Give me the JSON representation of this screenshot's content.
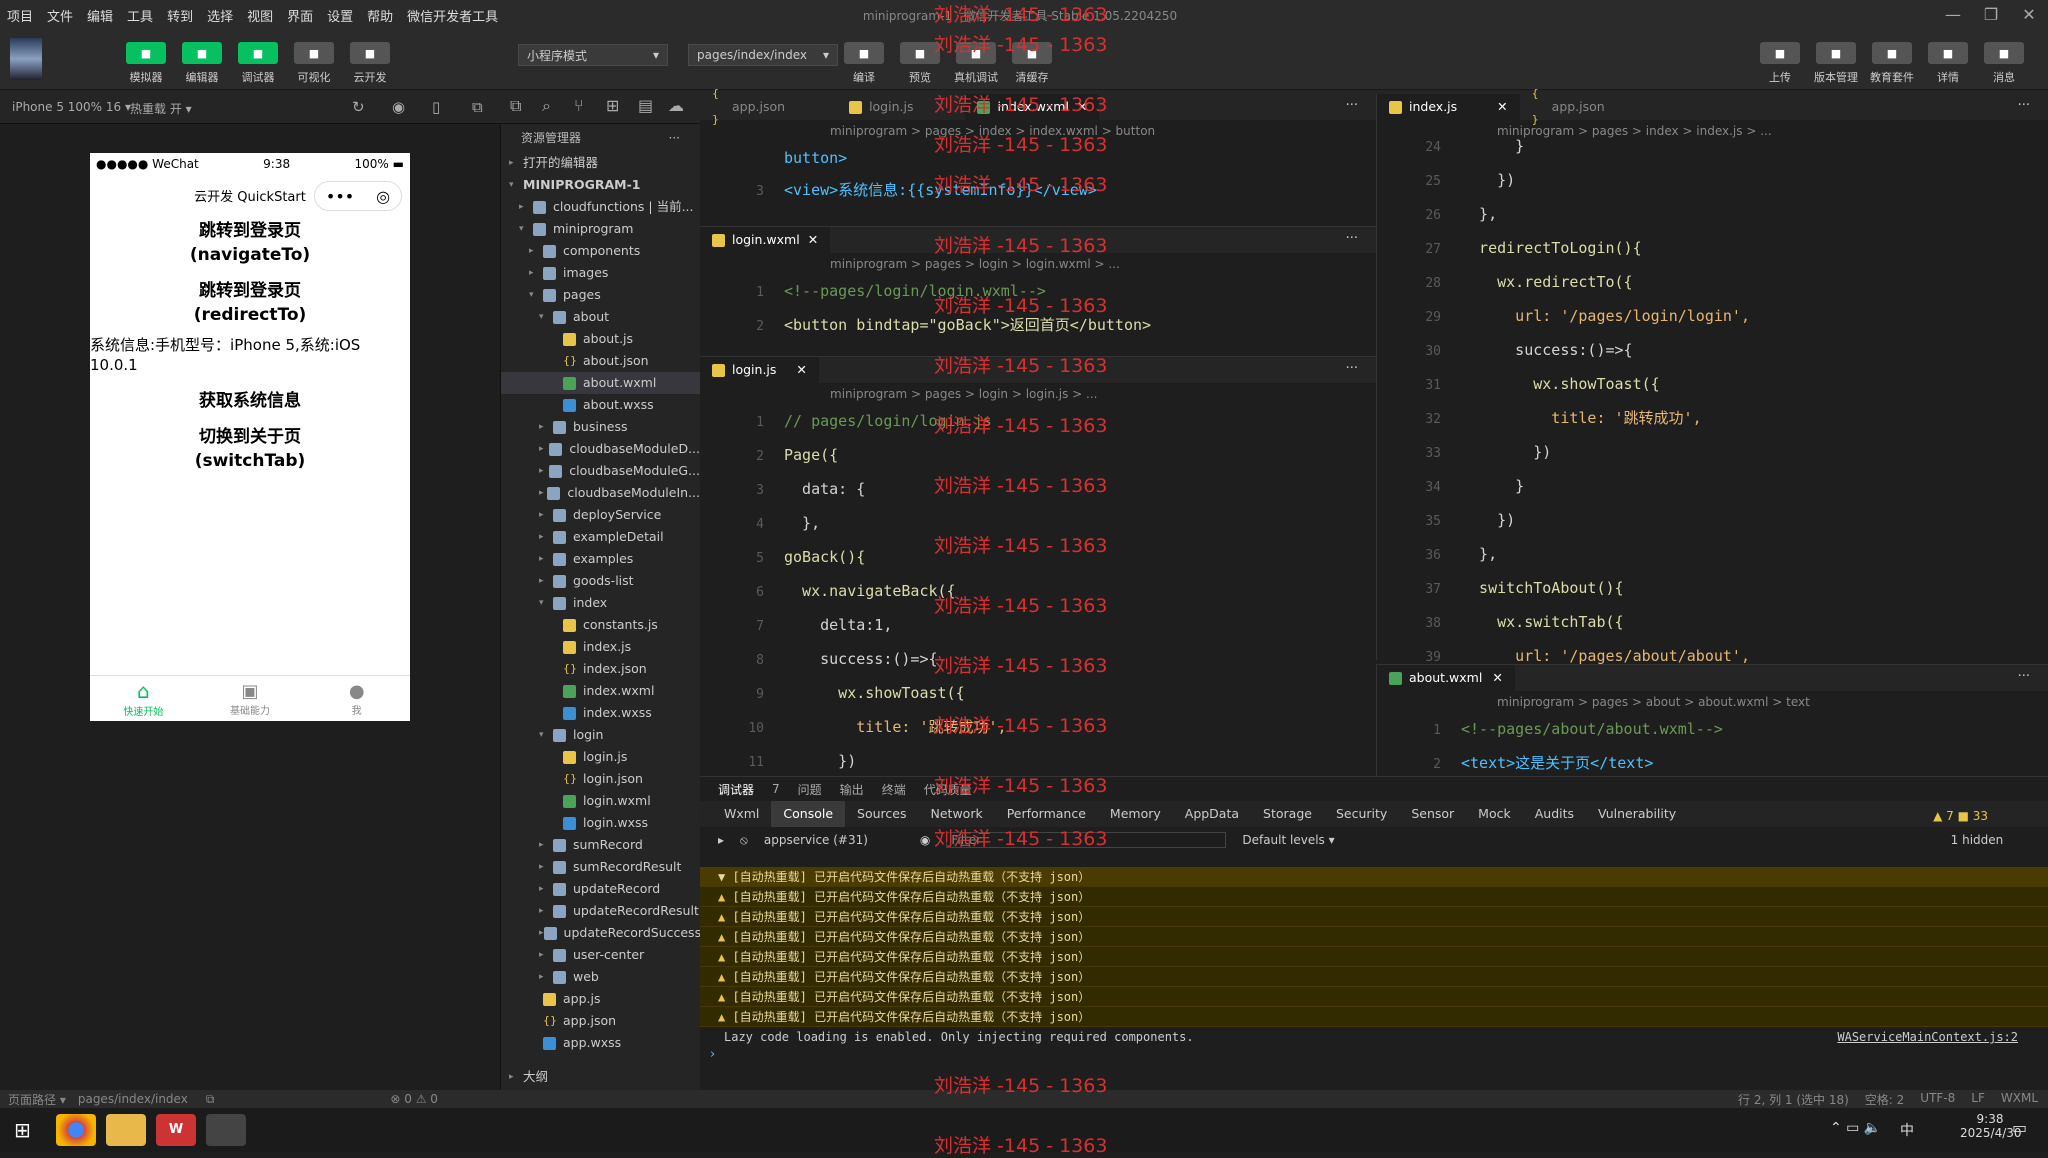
{
  "menubar": {
    "items": [
      "项目",
      "文件",
      "编辑",
      "工具",
      "转到",
      "选择",
      "视图",
      "界面",
      "设置",
      "帮助",
      "微信开发者工具"
    ]
  },
  "window": {
    "title": "miniprogram-1 · 微信开发者工具 Stable 1.05.2204250"
  },
  "toolbar": {
    "left": [
      {
        "label": "模拟器"
      },
      {
        "label": "编辑器"
      },
      {
        "label": "调试器"
      },
      {
        "label": "可视化"
      },
      {
        "label": "云开发"
      }
    ],
    "mode_select": "小程序模式",
    "page_select": "pages/index/index",
    "mid": [
      {
        "label": "编译"
      },
      {
        "label": "预览"
      },
      {
        "label": "真机调试"
      },
      {
        "label": "清缓存"
      }
    ],
    "right": [
      {
        "label": "上传"
      },
      {
        "label": "版本管理"
      },
      {
        "label": "教育套件"
      },
      {
        "label": "详情"
      },
      {
        "label": "消息"
      }
    ]
  },
  "subbar": {
    "device": "iPhone 5 100% 16 ▾",
    "hot_reload": "热重载 开 ▾"
  },
  "phone": {
    "carrier": "●●●●● WeChat",
    "time": "9:38",
    "battery": "100%",
    "nav_title": "云开发 QuickStart",
    "buttons": [
      "跳转到登录页\n(navigateTo)",
      "跳转到登录页\n(redirectTo)"
    ],
    "sysinfo": "系统信息:手机型号：iPhone 5,系统:iOS 10.0.1",
    "buttons2": [
      "获取系统信息",
      "切换到关于页\n(switchTab)"
    ],
    "tabs": [
      "快速开始",
      "基础能力",
      "我"
    ]
  },
  "explorer": {
    "title": "资源管理器",
    "open_editors": "打开的编辑器",
    "project": "MINIPROGRAM-1",
    "rows": [
      {
        "indent": 1,
        "type": "folder",
        "name": "cloudfunctions | 当前...",
        "arrow": "▸"
      },
      {
        "indent": 1,
        "type": "folder",
        "name": "miniprogram",
        "arrow": "▾"
      },
      {
        "indent": 2,
        "type": "folder",
        "name": "components",
        "arrow": "▸"
      },
      {
        "indent": 2,
        "type": "folder",
        "name": "images",
        "arrow": "▸"
      },
      {
        "indent": 2,
        "type": "folder",
        "name": "pages",
        "arrow": "▾"
      },
      {
        "indent": 3,
        "type": "folder",
        "name": "about",
        "arrow": "▾"
      },
      {
        "indent": 4,
        "type": "js",
        "name": "about.js"
      },
      {
        "indent": 4,
        "type": "json",
        "name": "about.json"
      },
      {
        "indent": 4,
        "type": "wxml",
        "name": "about.wxml",
        "sel": true
      },
      {
        "indent": 4,
        "type": "wxss",
        "name": "about.wxss"
      },
      {
        "indent": 3,
        "type": "folder",
        "name": "business",
        "arrow": "▸"
      },
      {
        "indent": 3,
        "type": "folder",
        "name": "cloudbaseModuleD...",
        "arrow": "▸"
      },
      {
        "indent": 3,
        "type": "folder",
        "name": "cloudbaseModuleG...",
        "arrow": "▸"
      },
      {
        "indent": 3,
        "type": "folder",
        "name": "cloudbaseModuleIn...",
        "arrow": "▸"
      },
      {
        "indent": 3,
        "type": "folder",
        "name": "deployService",
        "arrow": "▸"
      },
      {
        "indent": 3,
        "type": "folder",
        "name": "exampleDetail",
        "arrow": "▸"
      },
      {
        "indent": 3,
        "type": "folder",
        "name": "examples",
        "arrow": "▸"
      },
      {
        "indent": 3,
        "type": "folder",
        "name": "goods-list",
        "arrow": "▸"
      },
      {
        "indent": 3,
        "type": "folder",
        "name": "index",
        "arrow": "▾"
      },
      {
        "indent": 4,
        "type": "js",
        "name": "constants.js"
      },
      {
        "indent": 4,
        "type": "js",
        "name": "index.js"
      },
      {
        "indent": 4,
        "type": "json",
        "name": "index.json"
      },
      {
        "indent": 4,
        "type": "wxml",
        "name": "index.wxml"
      },
      {
        "indent": 4,
        "type": "wxss",
        "name": "index.wxss"
      },
      {
        "indent": 3,
        "type": "folder",
        "name": "login",
        "arrow": "▾"
      },
      {
        "indent": 4,
        "type": "js",
        "name": "login.js"
      },
      {
        "indent": 4,
        "type": "json",
        "name": "login.json"
      },
      {
        "indent": 4,
        "type": "wxml",
        "name": "login.wxml"
      },
      {
        "indent": 4,
        "type": "wxss",
        "name": "login.wxss"
      },
      {
        "indent": 3,
        "type": "folder",
        "name": "sumRecord",
        "arrow": "▸"
      },
      {
        "indent": 3,
        "type": "folder",
        "name": "sumRecordResult",
        "arrow": "▸"
      },
      {
        "indent": 3,
        "type": "folder",
        "name": "updateRecord",
        "arrow": "▸"
      },
      {
        "indent": 3,
        "type": "folder",
        "name": "updateRecordResult",
        "arrow": "▸"
      },
      {
        "indent": 3,
        "type": "folder",
        "name": "updateRecordSuccess",
        "arrow": "▸"
      },
      {
        "indent": 3,
        "type": "folder",
        "name": "user-center",
        "arrow": "▸"
      },
      {
        "indent": 3,
        "type": "folder",
        "name": "web",
        "arrow": "▸"
      },
      {
        "indent": 2,
        "type": "js",
        "name": "app.js"
      },
      {
        "indent": 2,
        "type": "json",
        "name": "app.json"
      },
      {
        "indent": 2,
        "type": "wxss",
        "name": "app.wxss"
      }
    ],
    "outline": "大纲"
  },
  "editor_top": {
    "tabs": [
      "app.json",
      "login.js",
      "index.wxml"
    ],
    "crumb": "miniprogram  >  pages  >  index  >  index.wxml  >  button",
    "lines": [
      {
        "n": "",
        "html": "button>"
      },
      {
        "n": "3",
        "html": "<view>系统信息:{{systemInfo}}</view>"
      }
    ]
  },
  "editor_login_wxml": {
    "tab": "login.wxml",
    "crumb": "miniprogram  >  pages  >  login  >  login.wxml  >  ...",
    "lines": [
      {
        "n": "1",
        "text": "<!--pages/login/login.wxml-->"
      },
      {
        "n": "2",
        "text": "<button bindtap=\"goBack\">返回首页</button>"
      }
    ]
  },
  "editor_login_js": {
    "tab": "login.js",
    "crumb": "miniprogram  >  pages  >  login  >  login.js  >  ...",
    "lines": [
      {
        "n": "1",
        "text": "// pages/login/login.js"
      },
      {
        "n": "2",
        "text": "Page({"
      },
      {
        "n": "3",
        "text": "  data: {"
      },
      {
        "n": "4",
        "text": "  },"
      },
      {
        "n": "5",
        "text": "goBack(){"
      },
      {
        "n": "6",
        "text": "  wx.navigateBack({"
      },
      {
        "n": "7",
        "text": "    delta:1,"
      },
      {
        "n": "8",
        "text": "    success:()=>{"
      },
      {
        "n": "9",
        "text": "      wx.showToast({"
      },
      {
        "n": "10",
        "text": "        title: '跳转成功',"
      },
      {
        "n": "11",
        "text": "      })"
      }
    ]
  },
  "editor_index_js": {
    "tabs": [
      "index.js",
      "app.json"
    ],
    "crumb": "miniprogram  >  pages  >  index  >  index.js  >  ...",
    "lines": [
      {
        "n": "24",
        "text": "      }"
      },
      {
        "n": "25",
        "text": "    })"
      },
      {
        "n": "26",
        "text": "  },"
      },
      {
        "n": "27",
        "text": "  redirectToLogin(){"
      },
      {
        "n": "28",
        "text": "    wx.redirectTo({"
      },
      {
        "n": "29",
        "text": "      url: '/pages/login/login',"
      },
      {
        "n": "30",
        "text": "      success:()=>{"
      },
      {
        "n": "31",
        "text": "        wx.showToast({"
      },
      {
        "n": "32",
        "text": "          title: '跳转成功',"
      },
      {
        "n": "33",
        "text": "        })"
      },
      {
        "n": "34",
        "text": "      }"
      },
      {
        "n": "35",
        "text": "    })"
      },
      {
        "n": "36",
        "text": "  },"
      },
      {
        "n": "37",
        "text": "  switchToAbout(){"
      },
      {
        "n": "38",
        "text": "    wx.switchTab({"
      },
      {
        "n": "39",
        "text": "      url: '/pages/about/about',"
      }
    ]
  },
  "editor_about": {
    "tab": "about.wxml",
    "crumb": "miniprogram  >  pages  >  about  >  about.wxml  >  text",
    "lines": [
      {
        "n": "1",
        "text": "<!--pages/about/about.wxml-->"
      },
      {
        "n": "2",
        "text": "<text>这是关于页</text>"
      }
    ]
  },
  "console": {
    "tabs": [
      "调试器",
      "7",
      "问题",
      "输出",
      "终端",
      "代码质量"
    ],
    "devtabs": [
      "Wxml",
      "Console",
      "Sources",
      "Network",
      "Performance",
      "Memory",
      "AppData",
      "Storage",
      "Security",
      "Sensor",
      "Mock",
      "Audits",
      "Vulnerability"
    ],
    "counts": "▲ 7  ■ 33",
    "context": "appservice (#31)",
    "filter": "Filter",
    "levels": "Default levels ▾",
    "hidden": "1 hidden",
    "first": "[自动热重载] 已开启代码文件保存后自动热重载（不支持 json）",
    "warn": "[自动热重载] 已开启代码文件保存后自动热重载（不支持 json）",
    "warn_count": 7,
    "info": "Lazy code loading is enabled. Only injecting required components.",
    "source": "WAServiceMainContext.js:2"
  },
  "status": {
    "left1": "页面路径 ▾",
    "path": "pages/index/index",
    "errors": "⊗ 0 ⚠ 0",
    "right": [
      "行 2, 列 1 (选中 18)",
      "空格: 2",
      "UTF-8",
      "LF",
      "WXML"
    ]
  },
  "taskbar": {
    "time": "9:38",
    "date": "2025/4/30",
    "ime": "中"
  },
  "watermark": "刘浩洋 -145 - 1363"
}
